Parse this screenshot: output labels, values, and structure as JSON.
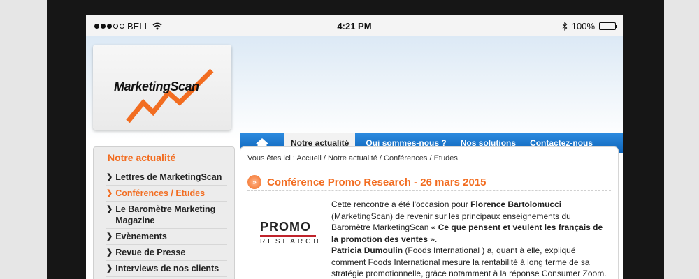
{
  "status_bar": {
    "carrier": "BELL",
    "time": "4:21 PM",
    "battery": "100%",
    "icons": [
      "signal-dots-icon",
      "wifi-icon",
      "bluetooth-icon",
      "battery-icon"
    ]
  },
  "logo": {
    "text": "MarketingScan"
  },
  "nav": {
    "home_icon": "home-icon",
    "items": [
      {
        "label": "Notre actualité",
        "active": true
      },
      {
        "label": "Qui sommes-nous ?",
        "active": false
      },
      {
        "label": "Nos solutions",
        "active": false
      },
      {
        "label": "Contactez-nous",
        "active": false
      }
    ]
  },
  "sidebar": {
    "title": "Notre actualité",
    "items": [
      {
        "label": "Lettres de MarketingScan",
        "active": false
      },
      {
        "label": "Conférences / Etudes",
        "active": true
      },
      {
        "label": "Le Baromètre Marketing Magazine",
        "active": false
      },
      {
        "label": "Evènements",
        "active": false
      },
      {
        "label": "Revue de Presse",
        "active": false
      },
      {
        "label": "Interviews de nos clients",
        "active": false
      }
    ]
  },
  "main": {
    "breadcrumb": "Vous êtes ici : Accueil / Notre actualité / Conférences / Etudes",
    "title_icon": "»",
    "title": "Conférence Promo Research - 26 mars 2015",
    "promo_logo": {
      "top": "PROMO",
      "bottom": "RESEARCH"
    },
    "para1": {
      "t1": "Cette rencontre a été l'occasion pour ",
      "b1": "Florence Bartolomucci",
      "t2": " (MarketingScan) de revenir sur les principaux enseignements du Baromètre MarketingScan « ",
      "b2": "Ce que pensent et veulent les français de la promotion des ventes",
      "t3": " »."
    },
    "para2": {
      "b1": "Patricia Dumoulin",
      "t1": " (Foods International ) a, quant à elle, expliqué comment Foods International mesure la rentabilité à long terme de sa stratégie promotionnelle, grâce notamment à la réponse Consumer Zoom."
    }
  },
  "colors": {
    "accent_orange": "#f26d21",
    "nav_blue": "#1a75cc"
  }
}
